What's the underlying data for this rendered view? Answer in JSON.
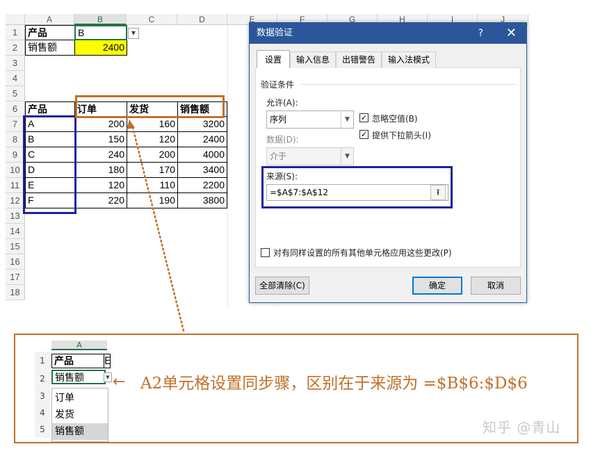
{
  "sheet": {
    "columns": [
      "A",
      "B",
      "C",
      "D",
      "E",
      "F",
      "G",
      "H",
      "I",
      "J"
    ],
    "rows": [
      "1",
      "2",
      "3",
      "4",
      "5",
      "6",
      "7",
      "8",
      "9",
      "10",
      "11",
      "12",
      "13",
      "14",
      "15",
      "16",
      "17",
      "18"
    ],
    "a1": "产品",
    "b1": "B",
    "a2": "销售额",
    "b2": "2400",
    "table_headers": [
      "产品",
      "订单",
      "发货",
      "销售额"
    ],
    "table_rows": [
      [
        "A",
        "200",
        "160",
        "3200"
      ],
      [
        "B",
        "150",
        "120",
        "2400"
      ],
      [
        "C",
        "240",
        "200",
        "4000"
      ],
      [
        "D",
        "180",
        "170",
        "3400"
      ],
      [
        "E",
        "120",
        "110",
        "2200"
      ],
      [
        "F",
        "220",
        "190",
        "3800"
      ]
    ]
  },
  "dialog": {
    "title": "数据验证",
    "help": "?",
    "close": "✕",
    "tabs": [
      "设置",
      "输入信息",
      "出错警告",
      "输入法模式"
    ],
    "section": "验证条件",
    "allow_label": "允许(A):",
    "allow_value": "序列",
    "data_label": "数据(D):",
    "data_value": "介于",
    "ignore_blank": "忽略空值(B)",
    "dropdown_arrow": "提供下拉箭头(I)",
    "source_label": "来源(S):",
    "source_value": "=$A$7:$A$12",
    "apply_all": "对有同样设置的所有其他单元格应用这些更改(P)",
    "clear_all": "全部清除(C)",
    "ok": "确定",
    "cancel": "取消"
  },
  "bottom": {
    "col": "A",
    "rows": [
      "1",
      "2",
      "3",
      "4",
      "5"
    ],
    "a1": "产品",
    "b1_partial": "E",
    "a2": "销售额",
    "options": [
      "订单",
      "发货",
      "销售额"
    ],
    "arrow": "←",
    "annotation": "A2单元格设置同步骤，区别在于来源为 =$B$6:$D$6"
  },
  "watermark": "知乎 @青山",
  "colors": {
    "excel_green": "#217346",
    "dialog_blue": "#2b579a",
    "highlight_yellow": "#ffff00",
    "annotation_orange": "#c0702a",
    "annotation_navy": "#1f1fa0"
  }
}
